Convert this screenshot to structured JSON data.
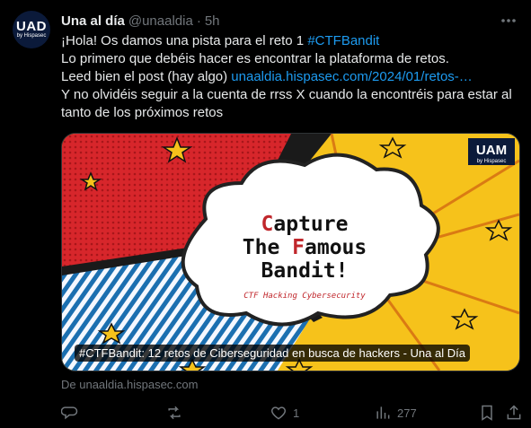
{
  "post": {
    "display_name": "Una al día",
    "handle": "@unaaldia",
    "separator": "·",
    "time": "5h",
    "avatar_logo": "UAD",
    "avatar_sub": "by Hispasec",
    "text": {
      "l1_pre": "¡Hola! Os damos una pista para el reto 1 ",
      "l1_hashtag": "#CTFBandit",
      "l2": "Lo primero que debéis hacer es encontrar la plataforma de retos.",
      "l3_pre": "Leed bien el post (hay algo) ",
      "l3_link": "unaaldia.hispasec.com/2024/01/retos-…",
      "l4": "Y no olvidéis seguir a la cuenta de rrss X cuando la encontréis para estar al",
      "l5": "tanto de los próximos retos"
    },
    "card": {
      "logo_text": "UAM",
      "logo_sub": "by Hispasec",
      "headline_1": "Capture",
      "headline_2": "The Famous",
      "headline_3": "Bandit!",
      "tagline": "CTF Hacking Cybersecurity",
      "title": "#CTFBandit: 12 retos de Ciberseguridad en busca de hackers - Una al Día"
    },
    "source": "De unaaldia.hispasec.com",
    "actions": {
      "replies": "",
      "reposts": "",
      "likes": "1",
      "views": "277"
    }
  },
  "colors": {
    "accent_link": "#1d9bf0",
    "muted": "#71767b",
    "text": "#e7e9ea",
    "background": "#000000"
  },
  "icons": [
    "more-icon",
    "reply-icon",
    "repost-icon",
    "like-icon",
    "views-icon",
    "bookmark-icon",
    "share-icon"
  ]
}
